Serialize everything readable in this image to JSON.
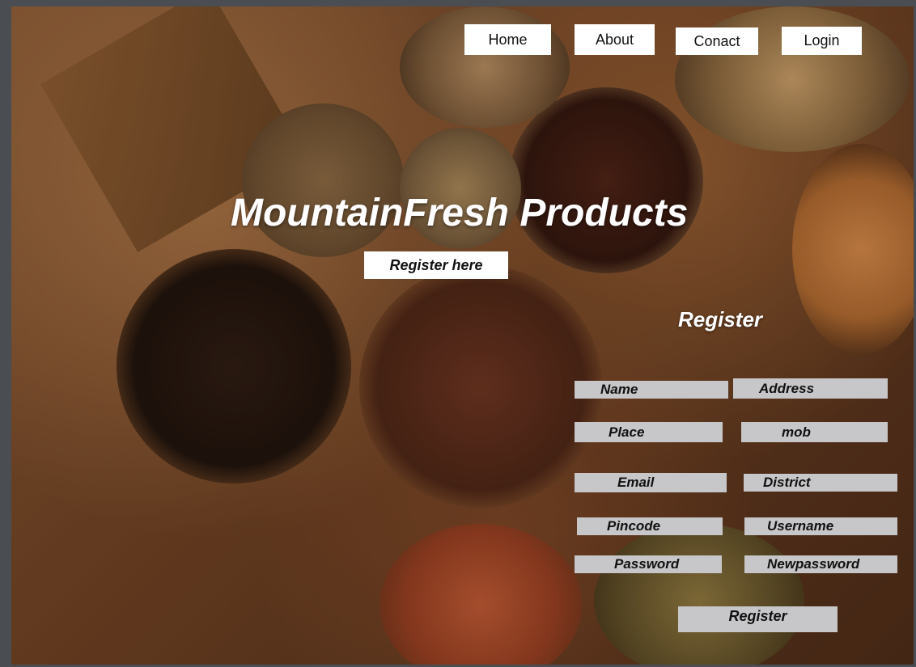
{
  "nav": {
    "home_label": "Home",
    "about_label": "About",
    "contact_label": "Conact",
    "login_label": "Login"
  },
  "hero": {
    "title": "MountainFresh Products",
    "register_here_label": "Register here"
  },
  "form": {
    "heading": "Register",
    "fields": {
      "name": "Name",
      "address": "Address",
      "place": "Place",
      "mob": "mob",
      "email": "Email",
      "district": "District",
      "pincode": "Pincode",
      "username": "Username",
      "password": "Password",
      "newpassword": "Newpassword"
    },
    "submit_label": "Register"
  }
}
